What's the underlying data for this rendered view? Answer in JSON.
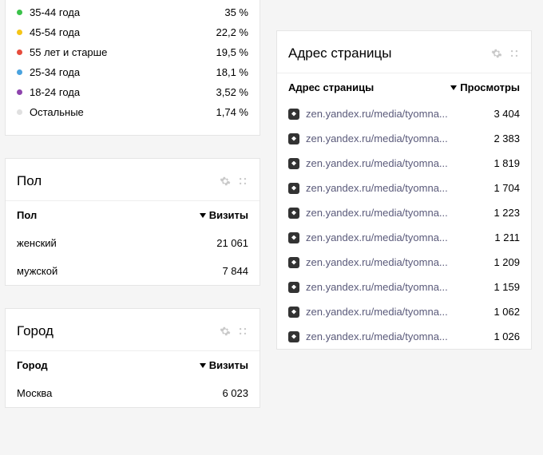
{
  "age": {
    "rows": [
      {
        "label": "35-44 года",
        "value": "35 %",
        "color": "#3bc24a"
      },
      {
        "label": "45-54 года",
        "value": "22,2 %",
        "color": "#f5c518"
      },
      {
        "label": "55 лет и старше",
        "value": "19,5 %",
        "color": "#e74c3c"
      },
      {
        "label": "25-34 года",
        "value": "18,1 %",
        "color": "#4aa3df"
      },
      {
        "label": "18-24 года",
        "value": "3,52 %",
        "color": "#8e44ad"
      },
      {
        "label": "Остальные",
        "value": "1,74 %",
        "color": "#e0e0e0"
      }
    ]
  },
  "gender": {
    "title": "Пол",
    "col_label": "Пол",
    "col_value": "Визиты",
    "rows": [
      {
        "label": "женский",
        "value": "21 061"
      },
      {
        "label": "мужской",
        "value": "7 844"
      }
    ]
  },
  "city": {
    "title": "Город",
    "col_label": "Город",
    "col_value": "Визиты",
    "rows": [
      {
        "label": "Москва",
        "value": "6 023"
      }
    ]
  },
  "pages": {
    "title": "Адрес страницы",
    "col_label": "Адрес страницы",
    "col_value": "Просмотры",
    "rows": [
      {
        "label": "zen.yandex.ru/media/tyomna...",
        "value": "3 404"
      },
      {
        "label": "zen.yandex.ru/media/tyomna...",
        "value": "2 383"
      },
      {
        "label": "zen.yandex.ru/media/tyomna...",
        "value": "1 819"
      },
      {
        "label": "zen.yandex.ru/media/tyomna...",
        "value": "1 704"
      },
      {
        "label": "zen.yandex.ru/media/tyomna...",
        "value": "1 223"
      },
      {
        "label": "zen.yandex.ru/media/tyomna...",
        "value": "1 211"
      },
      {
        "label": "zen.yandex.ru/media/tyomna...",
        "value": "1 209"
      },
      {
        "label": "zen.yandex.ru/media/tyomna...",
        "value": "1 159"
      },
      {
        "label": "zen.yandex.ru/media/tyomna...",
        "value": "1 062"
      },
      {
        "label": "zen.yandex.ru/media/tyomna...",
        "value": "1 026"
      }
    ]
  }
}
